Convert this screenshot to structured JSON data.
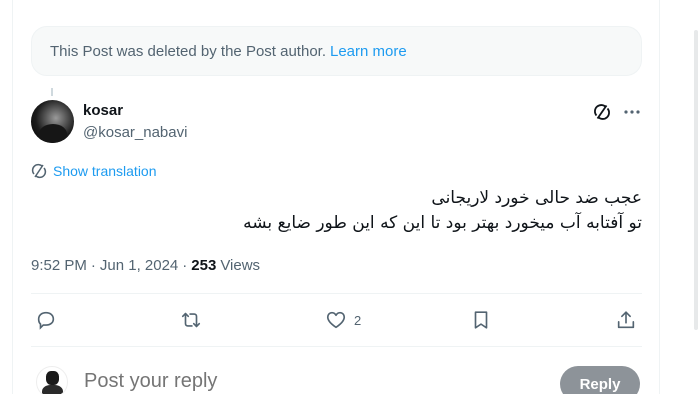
{
  "deleted_notice": {
    "text": "This Post was deleted by the Post author.",
    "link": "Learn more"
  },
  "post": {
    "author_name": "kosar",
    "author_handle": "@kosar_nabavi",
    "show_translation": "Show translation",
    "text_line1": "عجب ضد حالی خورد لاریجانی",
    "text_line2": "تو آفتابه آب میخورد بهتر بود تا این که این طور ضایع بشه",
    "time": "9:52 PM",
    "date": "Jun 1, 2024",
    "views_count": "253",
    "views_label": "Views"
  },
  "actions": {
    "like_count": "2"
  },
  "reply_box": {
    "placeholder": "Post your reply",
    "button": "Reply"
  },
  "colors": {
    "accent": "#1d9bf0",
    "secondary_text": "#536471",
    "primary_text": "#0f1419",
    "reply_button_disabled": "#8d9399"
  },
  "icons": [
    "grok-icon",
    "more-icon",
    "translate-icon",
    "reply-icon",
    "repost-icon",
    "like-icon",
    "bookmark-icon",
    "share-icon"
  ]
}
